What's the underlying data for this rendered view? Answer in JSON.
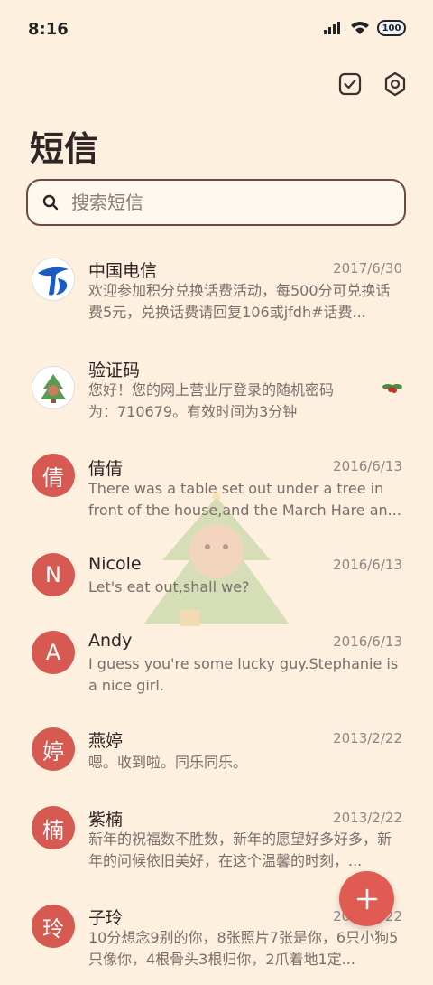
{
  "status": {
    "time": "8:16",
    "battery": "100"
  },
  "header": {
    "title": "短信"
  },
  "search": {
    "placeholder": "搜索短信"
  },
  "messages": [
    {
      "avatar": "",
      "name": "中国电信",
      "date": "2017/6/30",
      "preview": "欢迎参加积分兑换话费活动，每500分可兑换话费5元，兑换话费请回复106或jfdh#话费..."
    },
    {
      "avatar": "",
      "name": "验证码",
      "date": "",
      "preview": "您好！您的网上营业厅登录的随机密码为：710679。有效时间为3分钟"
    },
    {
      "avatar": "倩",
      "name": "倩倩",
      "date": "2016/6/13",
      "preview": "There was a table set out under a tree in front of the house,and the March Hare an..."
    },
    {
      "avatar": "N",
      "name": "Nicole",
      "date": "2016/6/13",
      "preview": "Let's eat out,shall we?"
    },
    {
      "avatar": "A",
      "name": "Andy",
      "date": "2016/6/13",
      "preview": "I guess you're some lucky guy.Stephanie is a nice girl."
    },
    {
      "avatar": "婷",
      "name": "燕婷",
      "date": "2013/2/22",
      "preview": "嗯。收到啦。同乐同乐。"
    },
    {
      "avatar": "楠",
      "name": "紫楠",
      "date": "2013/2/22",
      "preview": "新年的祝福数不胜数，新年的愿望好多好多，新年的问候依旧美好，在这个温馨的时刻，..."
    },
    {
      "avatar": "玲",
      "name": "子玲",
      "date": "2013/2/22",
      "preview": "10分想念9别的你，8张照片7张是你，6只小狗5只像你，4根骨头3根归你，2爪着地1定..."
    }
  ],
  "colors": {
    "background": "#fdf0df",
    "avatar": "#d75a52",
    "fab": "#e05c53"
  }
}
